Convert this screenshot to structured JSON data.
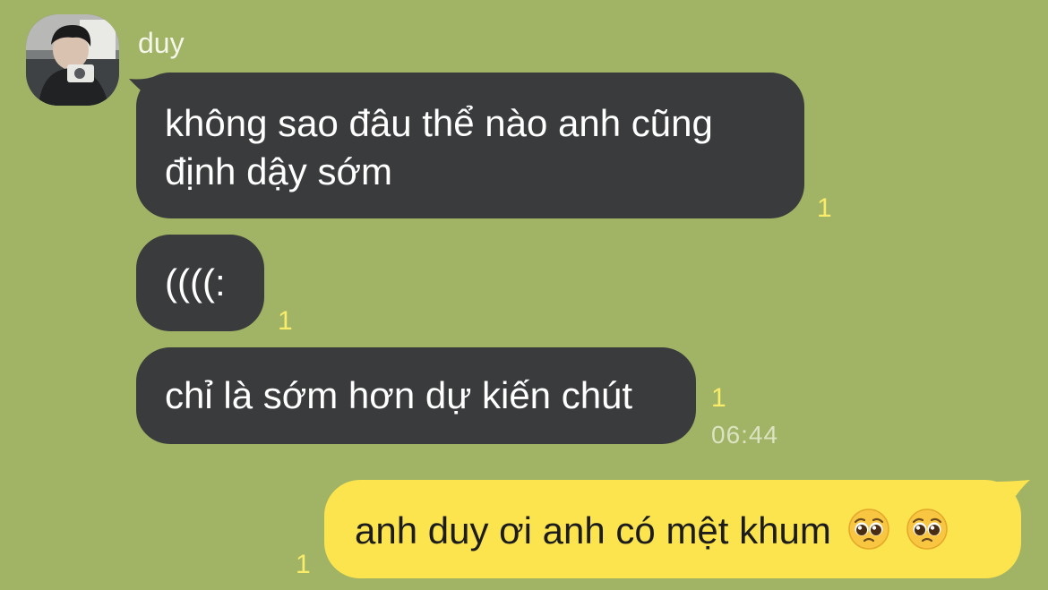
{
  "chat": {
    "contact_name": "duy",
    "colors": {
      "background": "#a1b365",
      "incoming_bubble": "#3a3b3d",
      "outgoing_bubble": "#fbe44e",
      "read_count": "#f8ec6a"
    },
    "messages": [
      {
        "direction": "incoming",
        "line1": "không sao đâu thể nào anh cũng",
        "line2": "định dậy sớm",
        "unread": "1"
      },
      {
        "direction": "incoming",
        "text": "((((:",
        "unread": "1"
      },
      {
        "direction": "incoming",
        "text": "chỉ là sớm hơn dự kiến chút",
        "unread": "1",
        "time": "06:44"
      },
      {
        "direction": "outgoing",
        "text": "anh duy ơi anh có mệt khum",
        "emoji": [
          "pleading-face-icon",
          "pleading-face-icon"
        ],
        "unread": "1"
      }
    ]
  }
}
